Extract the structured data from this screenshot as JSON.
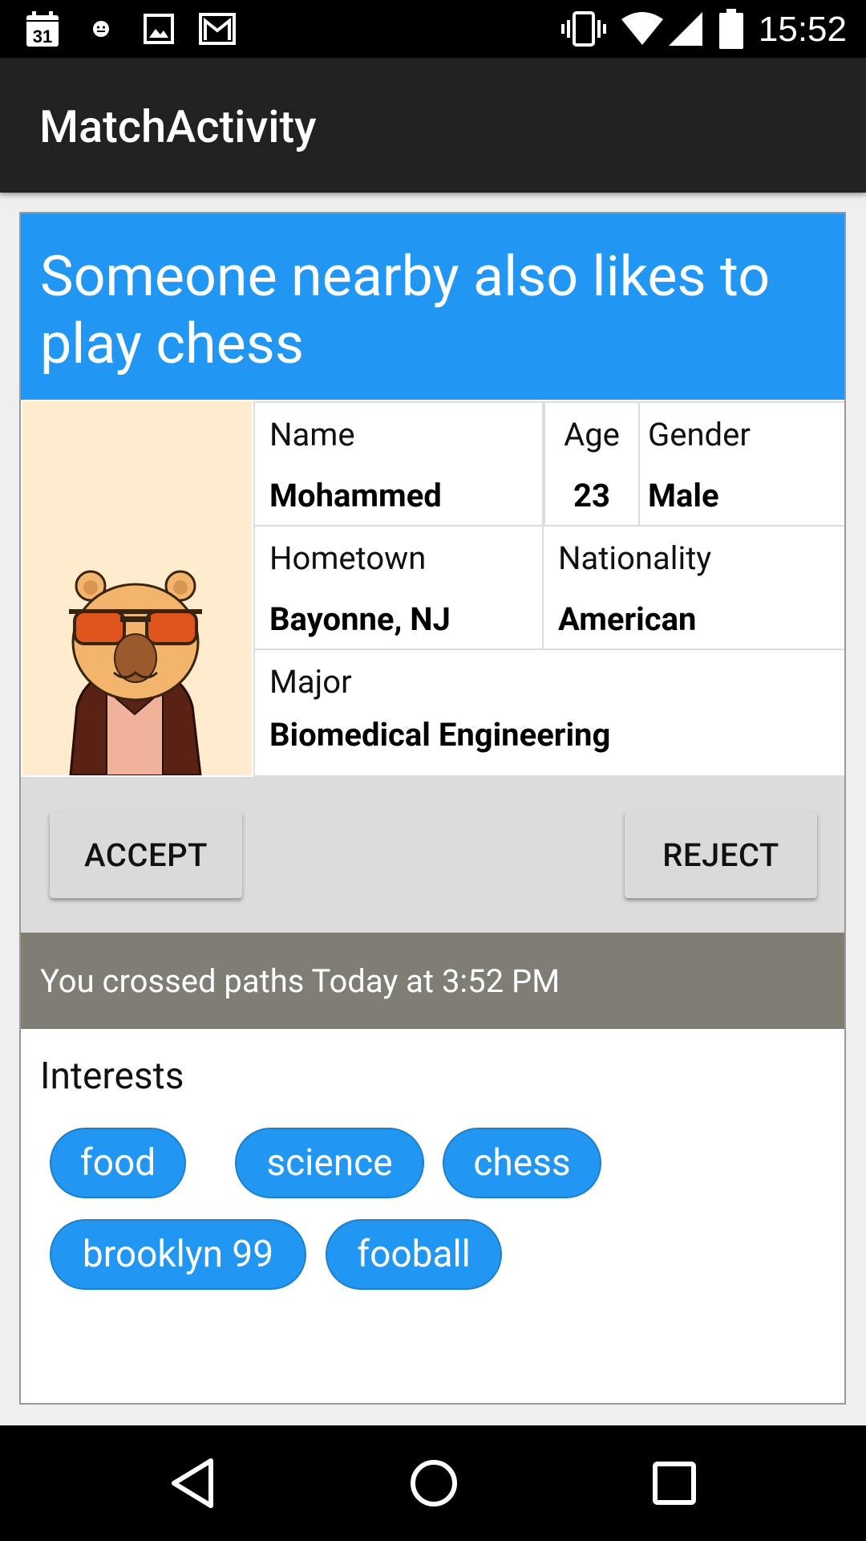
{
  "status_bar": {
    "time": "15:52",
    "calendar_day": "31",
    "left_icons": [
      "calendar-icon",
      "notification-icon",
      "image-icon",
      "gmail-icon"
    ],
    "right_icons": [
      "vibrate-icon",
      "wifi-icon",
      "signal-icon",
      "battery-icon"
    ]
  },
  "app_bar": {
    "title": "MatchActivity"
  },
  "card": {
    "headline": "Someone nearby also likes to play chess",
    "profile": {
      "name_label": "Name",
      "name": "Mohammed",
      "age_label": "Age",
      "age": "23",
      "gender_label": "Gender",
      "gender": "Male",
      "hometown_label": "Hometown",
      "hometown": "Bayonne, NJ",
      "nationality_label": "Nationality",
      "nationality": "American",
      "major_label": "Major",
      "major": "Biomedical Engineering"
    },
    "actions": {
      "accept": "ACCEPT",
      "reject": "REJECT"
    },
    "crossed_paths": "You crossed paths Today at 3:52 PM",
    "interests_label": "Interests",
    "interests": [
      "food",
      "science",
      "chess",
      "brooklyn 99",
      "fooball"
    ]
  },
  "nav_bar": {
    "icons": [
      "back-icon",
      "home-icon",
      "recents-icon"
    ]
  },
  "colors": {
    "accent": "#2196f3",
    "app_bar": "#212121",
    "banner": "#807d75",
    "actions_bg": "#dcdcdc",
    "avatar_bg": "#ffebcd"
  }
}
